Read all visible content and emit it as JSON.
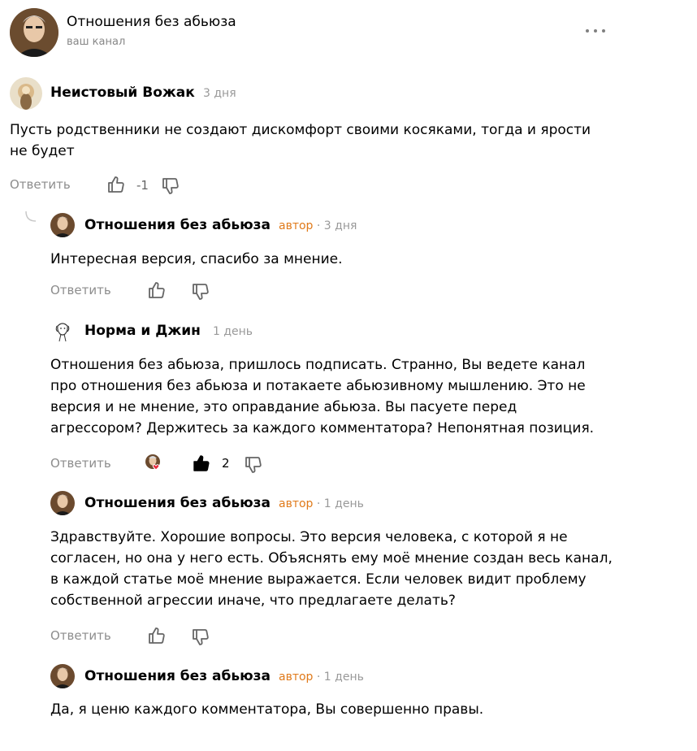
{
  "header": {
    "title": "Отношения без абьюза",
    "subtitle": "ваш канал",
    "more_icon": "more-horizontal-icon"
  },
  "comments": [
    {
      "author": "Неистовый Вожак",
      "author_tag": "",
      "time": "3 дня",
      "text": "Пусть родственники не создают дискомфорт своими косяками, тогда и ярости не будет",
      "reply_label": "Ответить",
      "like_count": "-1",
      "liked": false
    },
    {
      "author": "Отношения без абьюза",
      "author_tag": "автор",
      "time": "· 3 дня",
      "text": "Интересная версия, спасибо за мнение.",
      "reply_label": "Ответить",
      "like_count": "",
      "liked": false
    },
    {
      "author": "Норма и Джин",
      "author_tag": "",
      "time": "1 день",
      "text": "Отношения без абьюза, пришлось подписать. Странно, Вы ведете канал про отношения без абьюза и потакаете абьюзивному мышлению. Это не версия и не мнение, это оправдание абьюза. Вы пасуете перед агрессором? Держитесь за каждого комментатора? Непонятная позиция.",
      "reply_label": "Ответить",
      "like_count": "2",
      "liked": true
    },
    {
      "author": "Отношения без абьюза",
      "author_tag": "автор",
      "time": "· 1 день",
      "text": "Здравствуйте. Хорошие вопросы. Это версия человека, с которой я не согласен, но она у него есть. Объяснять ему моё мнение создан весь канал, в каждой статье моё мнение выражается. Если человек видит проблему собственной агрессии иначе, что предлагаете делать?",
      "reply_label": "Ответить",
      "like_count": "",
      "liked": false
    },
    {
      "author": "Отношения без абьюза",
      "author_tag": "автор",
      "time": "· 1 день",
      "text": "Да, я ценю каждого комментатора, Вы совершенно правы.",
      "reply_label": "",
      "like_count": "",
      "liked": false
    }
  ],
  "colors": {
    "author_tag": "#e07a1a",
    "meta": "#999999",
    "reply": "#8d8d8d"
  },
  "icons": {
    "like": "thumbs-up-icon",
    "dislike": "thumbs-down-icon",
    "liked_by_author_badge": "author-heart-badge-icon"
  }
}
